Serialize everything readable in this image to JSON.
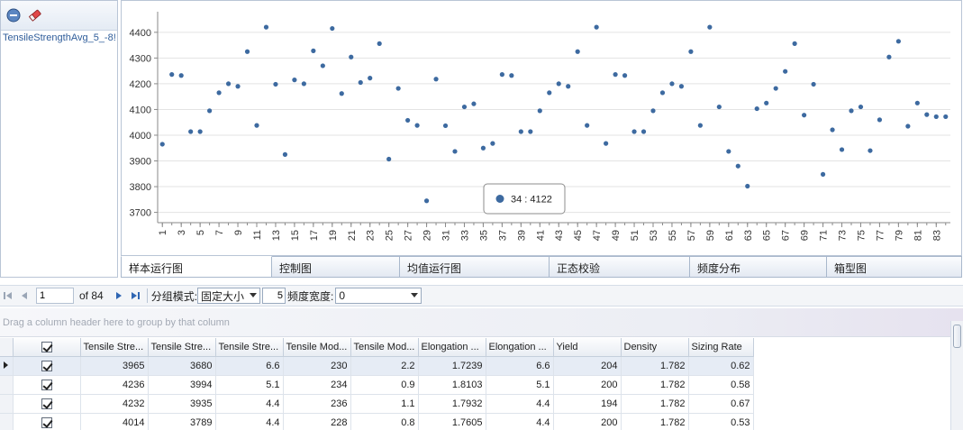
{
  "left_panel": {
    "series_label": "TensileStrengthAvg_5_-8!"
  },
  "chart_data": {
    "type": "scatter",
    "title": "",
    "xlabel": "",
    "ylabel": "",
    "xlim": [
      1,
      84
    ],
    "ylim": [
      3660,
      4480
    ],
    "y_ticks": [
      3700,
      3800,
      3900,
      4000,
      4100,
      4200,
      4300,
      4400
    ],
    "x_ticks": [
      1,
      3,
      5,
      7,
      9,
      11,
      13,
      15,
      17,
      19,
      21,
      23,
      25,
      27,
      29,
      31,
      33,
      35,
      37,
      39,
      41,
      43,
      45,
      47,
      49,
      51,
      53,
      55,
      57,
      59,
      61,
      63,
      65,
      67,
      69,
      71,
      73,
      75,
      77,
      79,
      81,
      83
    ],
    "grid": true,
    "point_color": "#3d6aa0",
    "x": [
      1,
      2,
      3,
      4,
      5,
      6,
      7,
      8,
      9,
      10,
      11,
      12,
      13,
      14,
      15,
      16,
      17,
      18,
      19,
      20,
      21,
      22,
      23,
      24,
      25,
      26,
      27,
      28,
      29,
      30,
      31,
      32,
      33,
      34,
      35,
      36,
      37,
      38,
      39,
      40,
      41,
      42,
      43,
      44,
      45,
      46,
      47,
      48,
      49,
      50,
      51,
      52,
      53,
      54,
      55,
      56,
      57,
      58,
      59,
      60,
      61,
      62,
      63,
      64,
      65,
      66,
      67,
      68,
      69,
      70,
      71,
      72,
      73,
      74,
      75,
      76,
      77,
      78,
      79,
      80,
      81,
      82,
      83,
      84
    ],
    "y": [
      3965,
      4236,
      4232,
      4014,
      4014,
      4095,
      4165,
      4200,
      4190,
      4325,
      4038,
      4420,
      4198,
      3925,
      4215,
      4200,
      4328,
      4270,
      4415,
      4162,
      4304,
      4205,
      4222,
      4356,
      3907,
      4182,
      4058,
      4038,
      3745,
      4218,
      4037,
      3937,
      4110,
      4122,
      3950,
      3968,
      4236,
      4232,
      4014,
      4014,
      4095,
      4165,
      4200,
      4190,
      4325,
      4038,
      4420,
      3968,
      4236,
      4232,
      4014,
      4014,
      4095,
      4165,
      4200,
      4190,
      4325,
      4038,
      4420,
      4110,
      3937,
      3880,
      3802,
      4103,
      4125,
      4182,
      4248,
      4356,
      4078,
      4198,
      3848,
      4021,
      3944,
      4095,
      4110,
      3940,
      4060,
      4304,
      4365,
      4035,
      4125,
      4080,
      4072,
      4072
    ],
    "tooltip": {
      "text": "34 : 4122"
    }
  },
  "chart_tabs": [
    {
      "label": "样本运行图",
      "active": true
    },
    {
      "label": "控制图",
      "active": false
    },
    {
      "label": "均值运行图",
      "active": false
    },
    {
      "label": "正态校验",
      "active": false
    },
    {
      "label": "频度分布",
      "active": false
    },
    {
      "label": "箱型图",
      "active": false
    }
  ],
  "pager": {
    "page": "1",
    "of_label": "of 84",
    "group_mode_label": "分组模式:",
    "group_mode_value": "固定大小",
    "group_size": "5",
    "freq_width_label": "频度宽度:",
    "freq_width_value": "0"
  },
  "group_panel": {
    "hint": "Drag a column header here to group by that column"
  },
  "grid": {
    "columns": [
      "Tensile Stre...",
      "Tensile Stre...",
      "Tensile Stre...",
      "Tensile Mod...",
      "Tensile Mod...",
      "Elongation ...",
      "Elongation ...",
      "Yield",
      "Density",
      "Sizing Rate"
    ],
    "rows": [
      [
        "3965",
        "3680",
        "6.6",
        "230",
        "2.2",
        "1.7239",
        "6.6",
        "204",
        "1.782",
        "0.62"
      ],
      [
        "4236",
        "3994",
        "5.1",
        "234",
        "0.9",
        "1.8103",
        "5.1",
        "200",
        "1.782",
        "0.58"
      ],
      [
        "4232",
        "3935",
        "4.4",
        "236",
        "1.1",
        "1.7932",
        "4.4",
        "194",
        "1.782",
        "0.67"
      ],
      [
        "4014",
        "3789",
        "4.4",
        "228",
        "0.8",
        "1.7605",
        "4.4",
        "200",
        "1.782",
        "0.53"
      ]
    ]
  },
  "colors": {
    "accent": "#3d6aa0",
    "border": "#b9c5d6",
    "grid_line": "#e3e3e3"
  }
}
